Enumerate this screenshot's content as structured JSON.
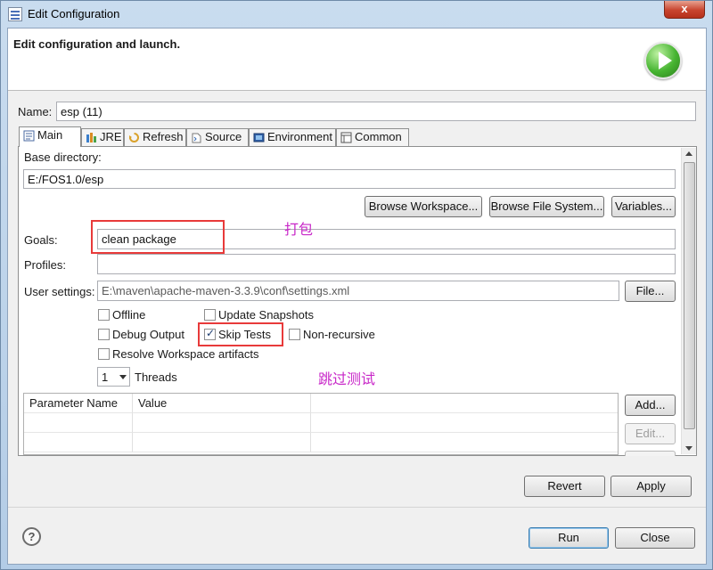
{
  "window": {
    "title": "Edit Configuration",
    "close_glyph": "x"
  },
  "header": {
    "title": "Edit configuration and launch.",
    "icon": "run-launch-icon"
  },
  "name_field": {
    "label": "Name:",
    "value": "esp (11)"
  },
  "tabs": [
    {
      "label": "Main",
      "icon": "main-tab-icon"
    },
    {
      "label": "JRE",
      "icon": "jre-tab-icon"
    },
    {
      "label": "Refresh",
      "icon": "refresh-tab-icon"
    },
    {
      "label": "Source",
      "icon": "source-tab-icon"
    },
    {
      "label": "Environment",
      "icon": "environment-tab-icon"
    },
    {
      "label": "Common",
      "icon": "common-tab-icon"
    }
  ],
  "main": {
    "base_directory_label": "Base directory:",
    "base_directory_value": "E:/FOS1.0/esp",
    "browse_workspace": "Browse Workspace...",
    "browse_file_system": "Browse File System...",
    "variables": "Variables...",
    "goals_label": "Goals:",
    "goals_value": "clean package",
    "profiles_label": "Profiles:",
    "profiles_value": "",
    "user_settings_label": "User settings:",
    "user_settings_value": "E:\\maven\\apache-maven-3.3.9\\conf\\settings.xml",
    "file_button": "File...",
    "checkboxes": {
      "offline": {
        "label": "Offline",
        "checked": false
      },
      "update_snapshots": {
        "label": "Update Snapshots",
        "checked": false
      },
      "debug_output": {
        "label": "Debug Output",
        "checked": false
      },
      "skip_tests": {
        "label": "Skip Tests",
        "checked": true
      },
      "non_recursive": {
        "label": "Non-recursive",
        "checked": false
      },
      "resolve_workspace": {
        "label": "Resolve Workspace artifacts",
        "checked": false
      }
    },
    "threads_value": "1",
    "threads_label": "Threads",
    "param_table": {
      "columns": [
        "Parameter Name",
        "Value"
      ],
      "rows": []
    },
    "add_button": "Add...",
    "edit_button": "Edit..."
  },
  "annotations": {
    "goals_note": "打包",
    "skip_tests_note": "跳过测试",
    "highlight_color": "#e83a3a",
    "note_color": "#c827c8"
  },
  "actions": {
    "revert": "Revert",
    "apply": "Apply",
    "run": "Run",
    "close": "Close",
    "help_glyph": "?"
  }
}
